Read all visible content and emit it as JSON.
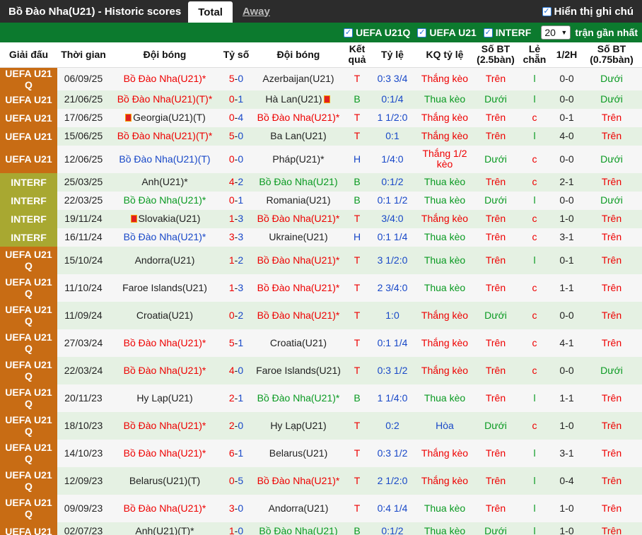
{
  "header": {
    "title": "Bồ Đào Nha(U21) - Historic scores",
    "tabs": [
      "Total",
      "Away"
    ],
    "show_handicap_label": "Hiển thị ghi chú"
  },
  "filters": {
    "items": [
      "UEFA U21Q",
      "UEFA U21",
      "INTERF"
    ],
    "count": "20",
    "recent_label": "trận gần nhất"
  },
  "columns": [
    "Giải đấu",
    "Thời gian",
    "Đội bóng",
    "Tỷ số",
    "Đội bóng",
    "Kết quả",
    "Tỷ lệ",
    "KQ tỷ lệ",
    "Số BT (2.5bàn)",
    "Lẻ chẵn",
    "1/2H",
    "Số BT (0.75bàn)"
  ],
  "colors": {
    "win_bet": "#e00000",
    "lose_bet": "#0a9a22",
    "comp_u21": "#c86c14",
    "comp_interf": "#a8a831",
    "header_green": "#0c7a2e"
  },
  "rows": [
    {
      "comp": "UEFA U21 Q",
      "date": "06/09/25",
      "home": "Bồ Đào Nha(U21)*",
      "hh": true,
      "hs": "5",
      "as": "0",
      "away": "Azerbaijan(U21)",
      "ah": false,
      "res": "T",
      "odds": "0:3 3/4",
      "kq": "Thắng kèo",
      "ou": "Trên",
      "oe": "l",
      "half": "0-0",
      "ou2": "Dưới"
    },
    {
      "comp": "UEFA U21",
      "date": "21/06/25",
      "home": "Bồ Đào Nha(U21)(T)*",
      "hh": true,
      "hs": "0",
      "as": "1",
      "away": "Hà Lan(U21)",
      "ah": false,
      "aflag": true,
      "res": "B",
      "odds": "0:1/4",
      "kq": "Thua kèo",
      "ou": "Dưới",
      "oe": "l",
      "half": "0-0",
      "ou2": "Dưới"
    },
    {
      "comp": "UEFA U21",
      "date": "17/06/25",
      "home": "Georgia(U21)(T)",
      "hh": false,
      "hflag": true,
      "hs": "0",
      "as": "4",
      "away": "Bồ Đào Nha(U21)*",
      "ah": true,
      "res": "T",
      "odds": "1 1/2:0",
      "kq": "Thắng kèo",
      "ou": "Trên",
      "oe": "c",
      "half": "0-1",
      "ou2": "Trên"
    },
    {
      "comp": "UEFA U21",
      "date": "15/06/25",
      "home": "Bồ Đào Nha(U21)(T)*",
      "hh": true,
      "hs": "5",
      "as": "0",
      "away": "Ba Lan(U21)",
      "ah": false,
      "res": "T",
      "odds": "0:1",
      "kq": "Thắng kèo",
      "ou": "Trên",
      "oe": "l",
      "half": "4-0",
      "ou2": "Trên"
    },
    {
      "comp": "UEFA U21",
      "date": "12/06/25",
      "home": "Bồ Đào Nha(U21)(T)",
      "hh": true,
      "hblue": true,
      "hs": "0",
      "as": "0",
      "away": "Pháp(U21)*",
      "ah": false,
      "res": "H",
      "odds": "1/4:0",
      "kq": "Thắng 1/2 kèo",
      "ou": "Dưới",
      "oe": "c",
      "half": "0-0",
      "ou2": "Dưới",
      "tall": true
    },
    {
      "comp": "INTERF",
      "date": "25/03/25",
      "home": "Anh(U21)*",
      "hh": false,
      "hs": "4",
      "as": "2",
      "away": "Bồ Đào Nha(U21)",
      "ah": true,
      "agreen": true,
      "res": "B",
      "odds": "0:1/2",
      "kq": "Thua kèo",
      "ou": "Trên",
      "oe": "c",
      "half": "2-1",
      "ou2": "Trên"
    },
    {
      "comp": "INTERF",
      "date": "22/03/25",
      "home": "Bồ Đào Nha(U21)*",
      "hh": true,
      "hgreen": true,
      "hs": "0",
      "as": "1",
      "away": "Romania(U21)",
      "ah": false,
      "res": "B",
      "odds": "0:1 1/2",
      "kq": "Thua kèo",
      "ou": "Dưới",
      "oe": "l",
      "half": "0-0",
      "ou2": "Dưới"
    },
    {
      "comp": "INTERF",
      "date": "19/11/24",
      "home": "Slovakia(U21)",
      "hh": false,
      "hflag": true,
      "hs": "1",
      "as": "3",
      "away": "Bồ Đào Nha(U21)*",
      "ah": true,
      "res": "T",
      "odds": "3/4:0",
      "kq": "Thắng kèo",
      "ou": "Trên",
      "oe": "c",
      "half": "1-0",
      "ou2": "Trên"
    },
    {
      "comp": "INTERF",
      "date": "16/11/24",
      "home": "Bồ Đào Nha(U21)*",
      "hh": true,
      "hblue": true,
      "hs": "3",
      "as": "3",
      "away": "Ukraine(U21)",
      "ah": false,
      "res": "H",
      "odds": "0:1 1/4",
      "kq": "Thua kèo",
      "ou": "Trên",
      "oe": "c",
      "half": "3-1",
      "ou2": "Trên"
    },
    {
      "comp": "UEFA U21 Q",
      "date": "15/10/24",
      "home": "Andorra(U21)",
      "hh": false,
      "hs": "1",
      "as": "2",
      "away": "Bồ Đào Nha(U21)*",
      "ah": true,
      "res": "T",
      "odds": "3 1/2:0",
      "kq": "Thua kèo",
      "ou": "Trên",
      "oe": "l",
      "half": "0-1",
      "ou2": "Trên",
      "tall": true
    },
    {
      "comp": "UEFA U21 Q",
      "date": "11/10/24",
      "home": "Faroe Islands(U21)",
      "hh": false,
      "hs": "1",
      "as": "3",
      "away": "Bồ Đào Nha(U21)*",
      "ah": true,
      "res": "T",
      "odds": "2 3/4:0",
      "kq": "Thua kèo",
      "ou": "Trên",
      "oe": "c",
      "half": "1-1",
      "ou2": "Trên",
      "tall": true
    },
    {
      "comp": "UEFA U21 Q",
      "date": "11/09/24",
      "home": "Croatia(U21)",
      "hh": false,
      "hs": "0",
      "as": "2",
      "away": "Bồ Đào Nha(U21)*",
      "ah": true,
      "res": "T",
      "odds": "1:0",
      "kq": "Thắng kèo",
      "ou": "Dưới",
      "oe": "c",
      "half": "0-0",
      "ou2": "Trên",
      "tall": true
    },
    {
      "comp": "UEFA U21 Q",
      "date": "27/03/24",
      "home": "Bồ Đào Nha(U21)*",
      "hh": true,
      "hs": "5",
      "as": "1",
      "away": "Croatia(U21)",
      "ah": false,
      "res": "T",
      "odds": "0:1 1/4",
      "kq": "Thắng kèo",
      "ou": "Trên",
      "oe": "c",
      "half": "4-1",
      "ou2": "Trên",
      "tall": true
    },
    {
      "comp": "UEFA U21 Q",
      "date": "22/03/24",
      "home": "Bồ Đào Nha(U21)*",
      "hh": true,
      "hs": "4",
      "as": "0",
      "away": "Faroe Islands(U21)",
      "ah": false,
      "res": "T",
      "odds": "0:3 1/2",
      "kq": "Thắng kèo",
      "ou": "Trên",
      "oe": "c",
      "half": "0-0",
      "ou2": "Dưới",
      "tall": true
    },
    {
      "comp": "UEFA U21 Q",
      "date": "20/11/23",
      "home": "Hy Lạp(U21)",
      "hh": false,
      "hs": "2",
      "as": "1",
      "away": "Bồ Đào Nha(U21)*",
      "ah": true,
      "agreen": true,
      "res": "B",
      "odds": "1 1/4:0",
      "kq": "Thua kèo",
      "ou": "Trên",
      "oe": "l",
      "half": "1-1",
      "ou2": "Trên",
      "tall": true
    },
    {
      "comp": "UEFA U21 Q",
      "date": "18/10/23",
      "home": "Bồ Đào Nha(U21)*",
      "hh": true,
      "hs": "2",
      "as": "0",
      "away": "Hy Lạp(U21)",
      "ah": false,
      "res": "T",
      "odds": "0:2",
      "kq": "Hòa",
      "ou": "Dưới",
      "oe": "c",
      "half": "1-0",
      "ou2": "Trên",
      "tall": true,
      "kqblue": true
    },
    {
      "comp": "UEFA U21 Q",
      "date": "14/10/23",
      "home": "Bồ Đào Nha(U21)*",
      "hh": true,
      "hs": "6",
      "as": "1",
      "away": "Belarus(U21)",
      "ah": false,
      "res": "T",
      "odds": "0:3 1/2",
      "kq": "Thắng kèo",
      "ou": "Trên",
      "oe": "l",
      "half": "3-1",
      "ou2": "Trên",
      "tall": true
    },
    {
      "comp": "UEFA U21 Q",
      "date": "12/09/23",
      "home": "Belarus(U21)(T)",
      "hh": false,
      "hs": "0",
      "as": "5",
      "away": "Bồ Đào Nha(U21)*",
      "ah": true,
      "res": "T",
      "odds": "2 1/2:0",
      "kq": "Thắng kèo",
      "ou": "Trên",
      "oe": "l",
      "half": "0-4",
      "ou2": "Trên",
      "tall": true
    },
    {
      "comp": "UEFA U21 Q",
      "date": "09/09/23",
      "home": "Bồ Đào Nha(U21)*",
      "hh": true,
      "hs": "3",
      "as": "0",
      "away": "Andorra(U21)",
      "ah": false,
      "res": "T",
      "odds": "0:4 1/4",
      "kq": "Thua kèo",
      "ou": "Trên",
      "oe": "l",
      "half": "1-0",
      "ou2": "Trên",
      "tall": true
    },
    {
      "comp": "UEFA U21",
      "date": "02/07/23",
      "home": "Anh(U21)(T)*",
      "hh": false,
      "hs": "1",
      "as": "0",
      "away": "Bồ Đào Nha(U21)",
      "ah": true,
      "agreen": true,
      "res": "B",
      "odds": "0:1/2",
      "kq": "Thua kèo",
      "ou": "Dưới",
      "oe": "l",
      "half": "1-0",
      "ou2": "Trên"
    }
  ]
}
